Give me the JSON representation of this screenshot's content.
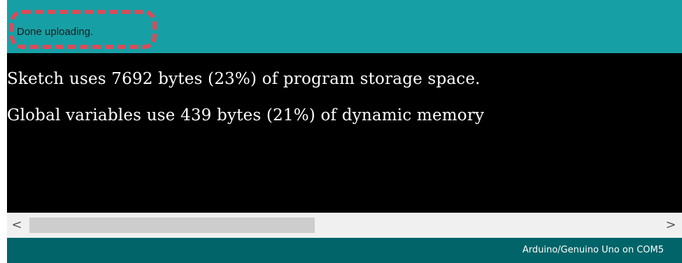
{
  "status": {
    "message": "Done uploading."
  },
  "console": {
    "lines": [
      "Sketch uses 7692 bytes (23%) of program storage space.",
      "Global variables use 439 bytes (21%) of dynamic memory"
    ]
  },
  "scrollbar": {
    "left_arrow": "<",
    "right_arrow": ">"
  },
  "footer": {
    "board_port": "Arduino/Genuino Uno on COM5"
  },
  "colors": {
    "status_bar": "#16a0a5",
    "console_bg": "#000000",
    "footer_bar": "#006468",
    "highlight": "#d94c5a"
  },
  "icons": {
    "scroll_left": "chevron-left-icon",
    "scroll_right": "chevron-right-icon"
  }
}
